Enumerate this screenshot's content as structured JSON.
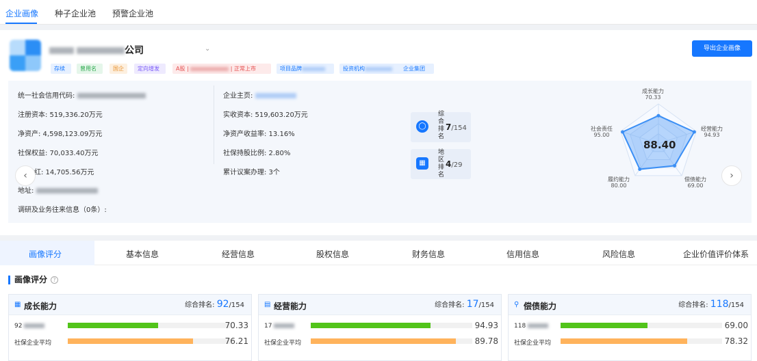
{
  "top_tabs": [
    "企业画像",
    "种子企业池",
    "预警企业池"
  ],
  "company": {
    "name_suffix": "公司",
    "export_button": "导出企业画像",
    "tags": [
      {
        "label": "存续",
        "color": "#1677ff",
        "bg": "#e6f0ff"
      },
      {
        "label": "曾用名",
        "color": "#2eaa4f",
        "bg": "#e5f6ea"
      },
      {
        "label": "国企",
        "color": "#e8912d",
        "bg": "#fdf0e0"
      },
      {
        "label": "定向增发",
        "color": "#7a5af8",
        "bg": "#eeeafe"
      },
      {
        "label": "A股 | ",
        "suffix": " | 正常上市",
        "color": "#e54d4d",
        "bg": "#fdeaea"
      },
      {
        "label": "项目品牌",
        "color": "#1677ff",
        "bg": "#e6f0ff"
      },
      {
        "label": "投资机构",
        "color": "#1677ff",
        "bg": "#e6f0ff"
      },
      {
        "label": "企业集团",
        "color": "#1677ff",
        "bg": "#e6f0ff"
      }
    ]
  },
  "info_left": {
    "credit_code_label": "统一社会信用代码:",
    "registered_capital": "注册资本: 519,336.20万元",
    "net_assets": "净资产: 4,598,123.09万元",
    "social_equity": "社保权益: 70,033.40万元",
    "dividend_suffix": "分红: 14,705.56万元",
    "address_label": "地址:",
    "research_label": "调研及业务往来信息（0条）:"
  },
  "info_right": {
    "main_business_label": "企业主页:",
    "paid_in_capital": "实收资本: 519,603.20万元",
    "roe": "净资产收益率: 13.16%",
    "social_share_ratio": "社保持股比例: 2.80%",
    "proposals": "累计议案办理: 3个"
  },
  "ranks": [
    {
      "label": "综合排名",
      "value": "7",
      "total": "/154",
      "icon": "building-icon"
    },
    {
      "label": "地区排名",
      "value": "4",
      "total": "/29",
      "icon": "map-icon"
    }
  ],
  "radar": {
    "center_score": "88.40",
    "axes": [
      {
        "name": "成长能力",
        "value": "70.33",
        "v": 70.33
      },
      {
        "name": "经营能力",
        "value": "94.93",
        "v": 94.93
      },
      {
        "name": "偿债能力",
        "value": "69.00",
        "v": 69.0
      },
      {
        "name": "履约能力",
        "value": "80.00",
        "v": 80.0
      },
      {
        "name": "社会责任",
        "value": "95.00",
        "v": 95.0
      }
    ],
    "color": "#3b8ff5"
  },
  "sub_tabs": [
    "画像评分",
    "基本信息",
    "经营信息",
    "股权信息",
    "财务信息",
    "信用信息",
    "风险信息",
    "企业价值评价体系"
  ],
  "section_title": "画像评分",
  "score_cards": [
    {
      "title": "成长能力",
      "icon": "grid-icon",
      "rank_label": "综合排名:",
      "rank": "92",
      "rank_total": "/154",
      "row1_label": "92",
      "row1_value": "70.33",
      "row1_pct": 70.33,
      "row2_label": "社保企业平均",
      "row2_value": "76.21",
      "row2_pct": 76.21
    },
    {
      "title": "经营能力",
      "icon": "bar-chart-icon",
      "rank_label": "综合排名:",
      "rank": "17",
      "rank_total": "/154",
      "row1_label": "17",
      "row1_value": "94.93",
      "row1_pct": 94.93,
      "row2_label": "社保企业平均",
      "row2_value": "89.78",
      "row2_pct": 89.78
    },
    {
      "title": "偿债能力",
      "icon": "location-icon",
      "rank_label": "综合排名:",
      "rank": "118",
      "rank_total": "/154",
      "row1_label": "118",
      "row1_value": "69.00",
      "row1_pct": 69.0,
      "row2_label": "社保企业平均",
      "row2_value": "78.32",
      "row2_pct": 78.32
    }
  ],
  "colors": {
    "primary": "#1677ff",
    "bar_company": "#52c41a",
    "bar_average": "#ffb35c"
  }
}
